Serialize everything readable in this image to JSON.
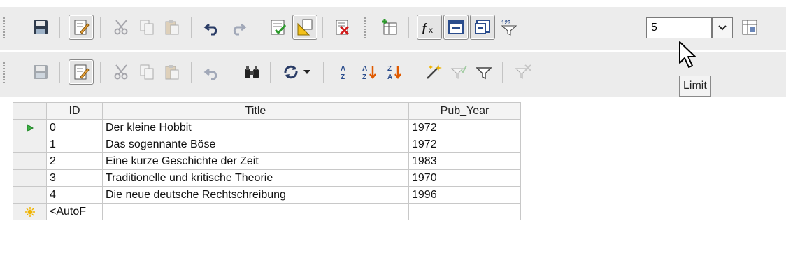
{
  "toolbar_main": {
    "limit_value": "5",
    "tooltip": "Limit",
    "icons": [
      "save-icon",
      "edit-data-icon",
      "cut-icon",
      "copy-icon",
      "paste-icon",
      "undo-icon",
      "redo-icon",
      "run-query-icon",
      "design-view-icon",
      "clear-query-icon",
      "add-tables-icon",
      "functions-icon",
      "table-name-icon",
      "alias-icon",
      "distinct-values-icon",
      "limit-filter-icon",
      "limit-dropdown-icon",
      "switch-design-icon"
    ]
  },
  "toolbar_data": {
    "icons": [
      "save-record-icon",
      "edit-data-icon",
      "cut-icon",
      "copy-icon",
      "paste-icon",
      "undo-icon",
      "find-record-icon",
      "refresh-icon",
      "refresh-menu-icon",
      "sort-icon",
      "sort-ascending-icon",
      "sort-descending-icon",
      "autofilter-icon",
      "apply-filter-icon",
      "standard-filter-icon",
      "remove-filter-icon"
    ]
  },
  "grid": {
    "columns": [
      "ID",
      "Title",
      "Pub_Year"
    ],
    "rows": [
      {
        "id": "0",
        "title": "Der kleine Hobbit",
        "year": "1972"
      },
      {
        "id": "1",
        "title": "Das sogennante Böse",
        "year": "1972"
      },
      {
        "id": "2",
        "title": "Eine kurze Geschichte der Zeit",
        "year": "1983"
      },
      {
        "id": "3",
        "title": "Traditionelle und kritische Theorie",
        "year": "1970"
      },
      {
        "id": "4",
        "title": "Die neue deutsche Rechtschreibung",
        "year": "1996"
      }
    ],
    "new_row": {
      "id": "<AutoF",
      "title": "",
      "year": ""
    }
  },
  "colors": {
    "toolbar_bg": "#ececec",
    "current_row_marker": "#3cb043",
    "new_row_marker": "#f0b400"
  }
}
